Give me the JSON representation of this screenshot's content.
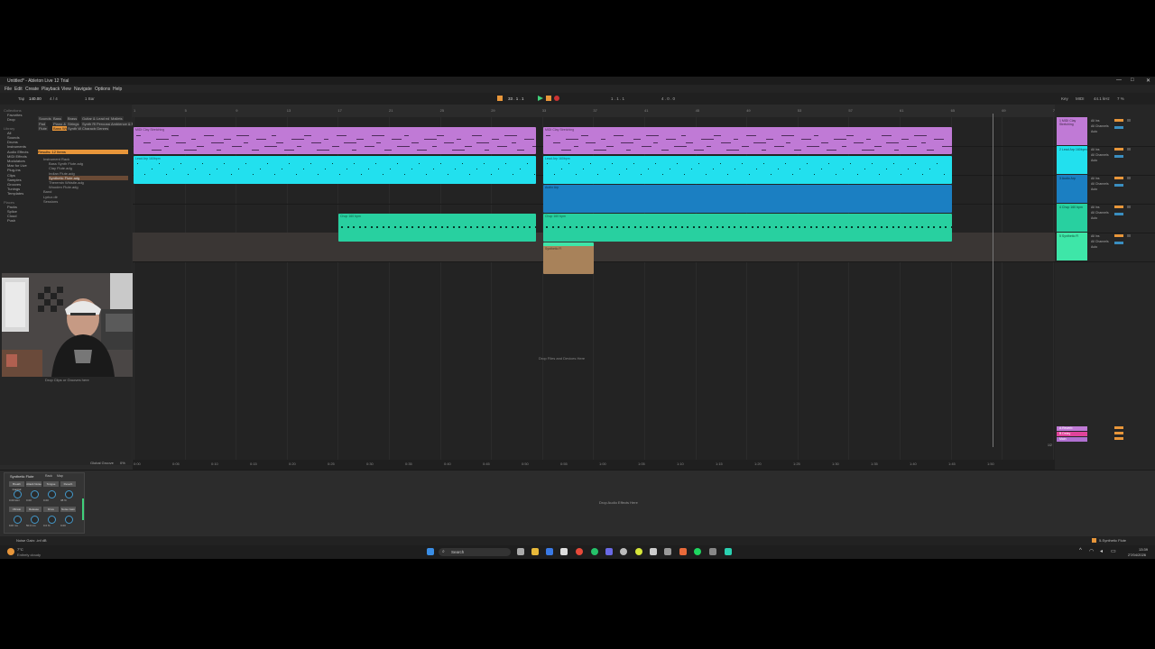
{
  "window": {
    "title": "Untitled* - Ableton Live 12 Trial",
    "controls": [
      "—",
      "□",
      "✕"
    ]
  },
  "menu": [
    "File",
    "Edit",
    "Create",
    "Playback",
    "View",
    "Navigate",
    "Options",
    "Help"
  ],
  "control_bar": {
    "tap": "Tap",
    "tempo": "140.00",
    "signature": "4 / 4",
    "quantize": "1 Bar",
    "position": "33 . 1 . 1",
    "loop_start": "1 . 1 . 1",
    "loop_length": "4 . 0 . 0",
    "key": "Key",
    "midi": "MIDI",
    "cpu": "44.1 kHz",
    "cpu_pct": "7 %"
  },
  "browser": {
    "sections": {
      "collections": [
        "Collections",
        "Favorites",
        "Drop"
      ],
      "library": [
        "Library",
        "All",
        "Sounds",
        "Drums",
        "Instruments",
        "Audio Effects",
        "MIDI Effects",
        "Modulators",
        "Max for Live",
        "Plug-Ins",
        "Clips",
        "Samples",
        "Grooves",
        "Tunings",
        "Templates"
      ],
      "places": [
        "Places",
        "Packs",
        "Splice",
        "Cloud",
        "Push"
      ]
    },
    "filters": [
      "Sounds",
      "Bass",
      "Brass",
      "Guitar & Plucked",
      "Lead",
      "Mallets",
      "Pad",
      "Piano & Keys",
      "Strings",
      "Synth Rhythmic",
      "Percussive",
      "Ambience & FX",
      "Flute",
      "Bass Woodwind",
      "Synth Woodwind",
      "Character",
      "Genres"
    ],
    "results_header": "Results: 12 Items",
    "results": [
      "Instrument Rack",
      "Bass Synth Flute.adg",
      "Clay Flute.adg",
      "Indian Flute.adg",
      "Synthetic Flute.adg",
      "Theremin Whistle.adg",
      "Wooden Flute.adg",
      "Band",
      "Lyricz.dlr",
      "Sessions"
    ]
  },
  "webcam_caption": "Drop Clips or Grooves here",
  "ruler_ticks": [
    "1",
    "5",
    "9",
    "13",
    "17",
    "21",
    "25",
    "29",
    "33",
    "37",
    "41",
    "45",
    "49",
    "53",
    "57",
    "61",
    "65",
    "69",
    "73"
  ],
  "tracks": [
    {
      "name": "1 MIDI Clay Stretching",
      "color": "#c07ad6"
    },
    {
      "name": "2 Lead Arp 160bpm",
      "color": "#22e0ee"
    },
    {
      "name": "3 Audio Arp",
      "color": "#1b7fc2"
    },
    {
      "name": "4 Chop 160 bpm",
      "color": "#28d0a0"
    },
    {
      "name": "5 Synthetic Fl",
      "color": "#3ee6a8"
    }
  ],
  "clips": {
    "track1": [
      "MIDI Clay Stretching",
      "MIDI Clay Stretching",
      "MIDI Clay Stretching",
      "MIDI Clay Stretching"
    ],
    "track2": [
      "Lead Arp 160bpm",
      "Lead Arp 160bpm",
      "Lead Arp 160bpm",
      "Lead Arp 160bpm"
    ],
    "track3": [
      "Audio Arp"
    ],
    "track4": [
      "Chop 160 bpm",
      "Chop 160 bpm"
    ],
    "track5": [
      "Synthetic Fl"
    ]
  },
  "arrangement_drop": "Drop Files and Devices Here",
  "time_ticks": [
    "0:00",
    "0:05",
    "0:10",
    "0:15",
    "0:20",
    "0:25",
    "0:30",
    "0:35",
    "0:40",
    "0:45",
    "0:50",
    "0:55",
    "1:00",
    "1:05",
    "1:10",
    "1:15",
    "1:20",
    "1:25",
    "1:30",
    "1:35",
    "1:40",
    "1:45",
    "1:50"
  ],
  "mixer": {
    "input_label": "All Ins",
    "channel_label": "All Channels",
    "monitor_label": "Auto",
    "returns": [
      "A Reverb",
      "B Delay",
      "Main"
    ],
    "page": "1/2"
  },
  "global_groove": "Global Groove",
  "groove_pct": "0%",
  "device": {
    "name": "Synthetic Flute",
    "buttons": [
      "Rack",
      "Map"
    ],
    "macros": [
      "Breath Control",
      "Attack Noise",
      "Tongue",
      "Reverb",
      "Vibrato",
      "Release",
      "Drive",
      "Noise Gain"
    ],
    "values": [
      "0.00 kHz",
      "0.00",
      "0.00",
      "38 %",
      "100 ms",
      "50.0 ms",
      "0.0 %",
      "0.00"
    ]
  },
  "detail_drop": "Drop Audio Effects Here",
  "status_left": "Noise Gain: -inf dB",
  "status_right": "5-Synthetic Flute",
  "taskbar": {
    "search": "Search",
    "weather_temp": "7°C",
    "weather_desc": "Entirely cloudy",
    "time": "13:39",
    "date": "27/04/2026"
  }
}
